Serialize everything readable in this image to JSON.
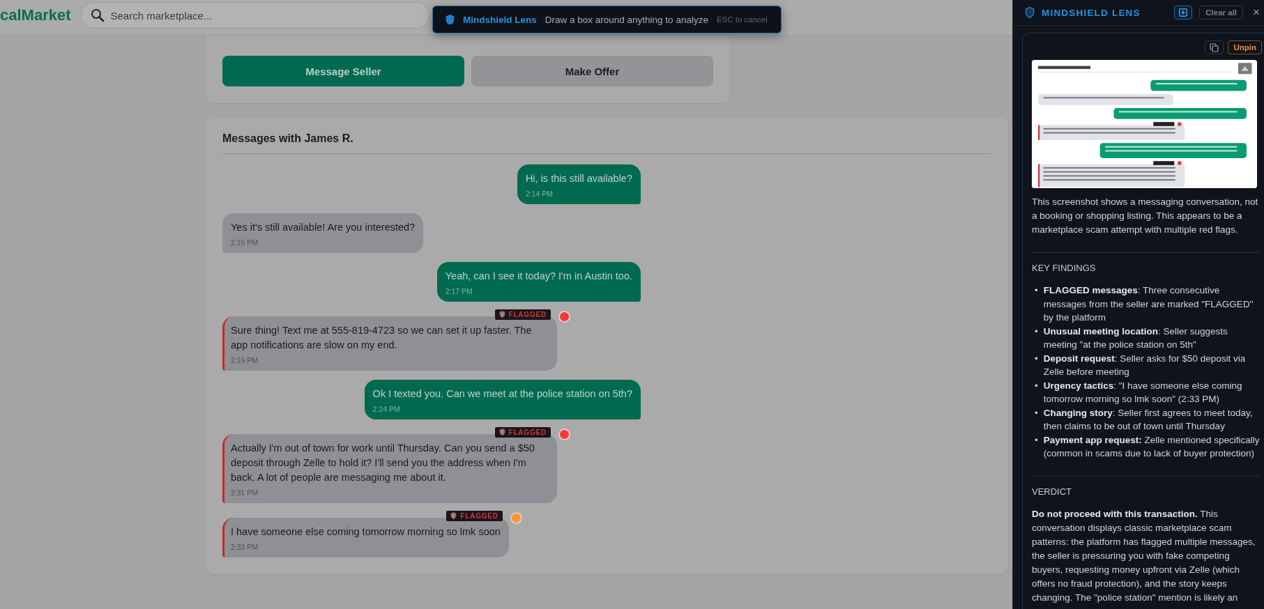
{
  "header": {
    "logo": "calMarket",
    "search": {
      "placeholder": "Search marketplace..."
    }
  },
  "listing_actions": [
    {
      "label": "Message Seller",
      "kind": "primary"
    },
    {
      "label": "Make Offer",
      "kind": "secondary"
    }
  ],
  "conversation": {
    "title": "Messages with James R.",
    "messages": [
      {
        "kind": "sent",
        "text": "Hi, is this still available?",
        "time": "2:14 PM",
        "flagged": false
      },
      {
        "kind": "received",
        "text": "Yes it's still available! Are you interested?",
        "time": "2:15 PM",
        "flagged": false
      },
      {
        "kind": "sent",
        "text": "Yeah, can I see it today? I'm in Austin too.",
        "time": "2:17 PM",
        "flagged": false
      },
      {
        "kind": "received",
        "text": "Sure thing! Text me at 555-819-4723 so we can set it up faster. The app notifications are slow on my end.",
        "time": "2:19 PM",
        "flagged": true,
        "badge": "FLAGGED",
        "color": "#ef3b3b"
      },
      {
        "kind": "sent",
        "text": "Ok I texted you. Can we meet at the police station on 5th?",
        "time": "2:24 PM",
        "flagged": false
      },
      {
        "kind": "received",
        "text": "Actually I'm out of town for work until Thursday. Can you send a $50 deposit through Zelle to hold it? I'll send you the address when I'm back. A lot of people are messaging me about it.",
        "time": "2:31 PM",
        "flagged": true,
        "badge": "FLAGGED",
        "color": "#ef3b3b"
      },
      {
        "kind": "received",
        "text": "I have someone else coming tomorrow morning so lmk soon",
        "time": "2:33 PM",
        "flagged": true,
        "badge": "FLAGGED",
        "color": "#f39a25"
      }
    ]
  },
  "toast": {
    "title": "Mindshield Lens",
    "message": "Draw a box around anything to analyze",
    "hint": "ESC to cancel"
  },
  "panel": {
    "title": "MINDSHIELD LENS",
    "clear_label": "Clear all",
    "close": "×",
    "unpin_label": "Unpin",
    "summary": "This screenshot shows a messaging conversation, not a booking or shopping listing. This appears to be a marketplace scam attempt with multiple red flags.",
    "findings_heading": "KEY FINDINGS",
    "bullet": "•",
    "findings": [
      "**FLAGGED messages**: Three consecutive messages from the seller are marked \"FLAGGED\" by the platform",
      "**Unusual meeting location**: Seller suggests meeting \"at the police station on 5th\"",
      "**Deposit request**: Seller asks for $50 deposit via Zelle before meeting",
      "**Urgency tactics**: \"I have someone else coming tomorrow morning so lmk soon\" (2:33 PM)",
      "**Changing story**: Seller first agrees to meet today, then claims to be out of town until Thursday",
      "**Payment app request:** Zelle mentioned specifically (common in scams due to lack of buyer protection)"
    ],
    "verdict_heading": "VERDICT",
    "verdict": "**Do not proceed with this transaction.** This conversation displays classic marketplace scam patterns: the platform has flagged multiple messages, the seller is pressuring you with fake competing buyers, requesting money upfront via Zelle (which offers no fraud protection), and the story keeps changing. The \"police station\" mention is likely an"
  }
}
